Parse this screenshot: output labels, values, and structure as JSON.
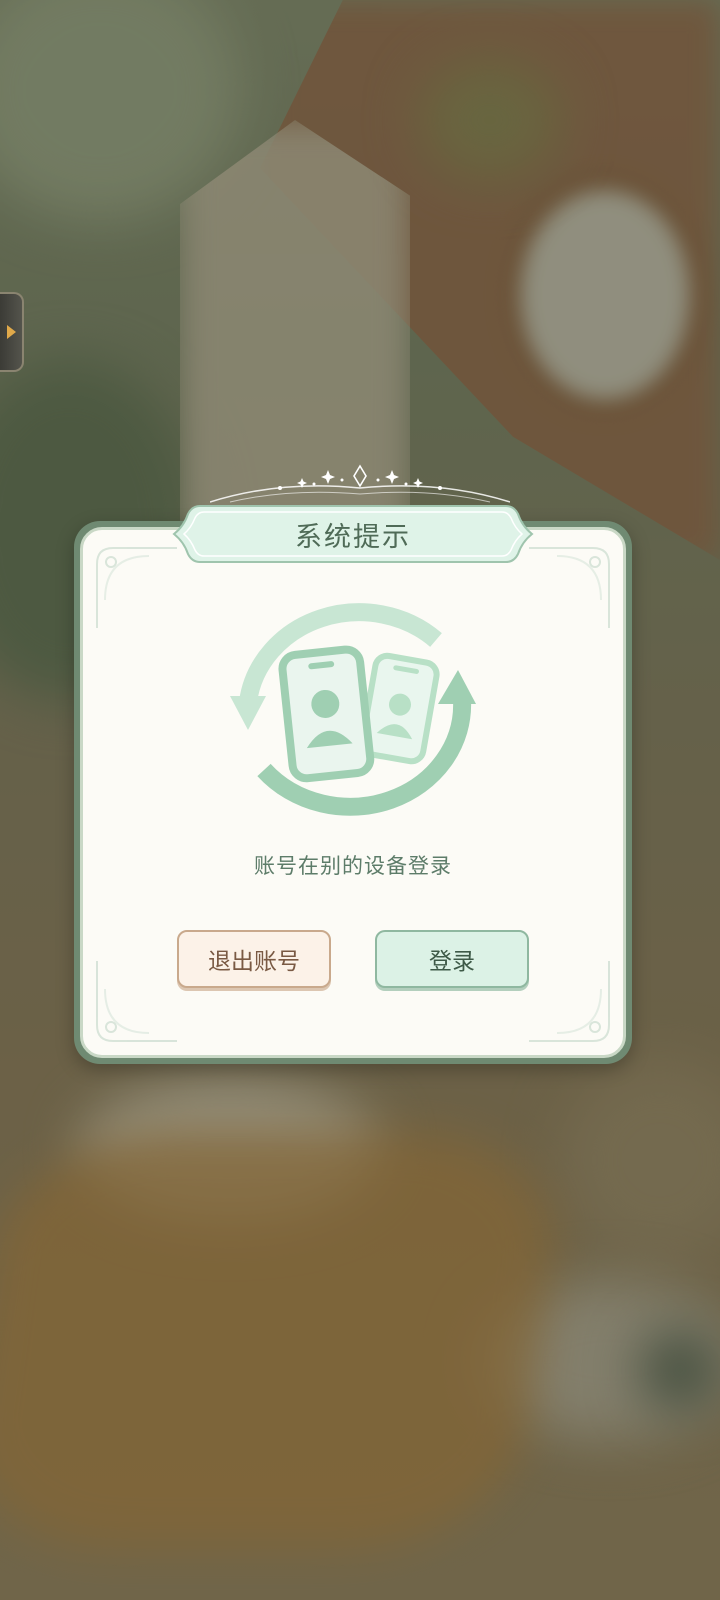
{
  "dialog": {
    "title": "系统提示",
    "message": "账号在别的设备登录",
    "logout_label": "退出账号",
    "login_label": "登录"
  },
  "colors": {
    "dialog_frame": "#6f8a72",
    "dialog_body": "#fcfbf6",
    "title_text": "#4f6b57",
    "message_text": "#5d7c69",
    "logout_button_bg": "#fcf2e8",
    "login_button_bg": "#dcf2e6",
    "illustration_green": "#9fcfb2"
  },
  "icons": {
    "side_tab": "chevron-right-icon",
    "illustration": "device-switch-icon"
  }
}
